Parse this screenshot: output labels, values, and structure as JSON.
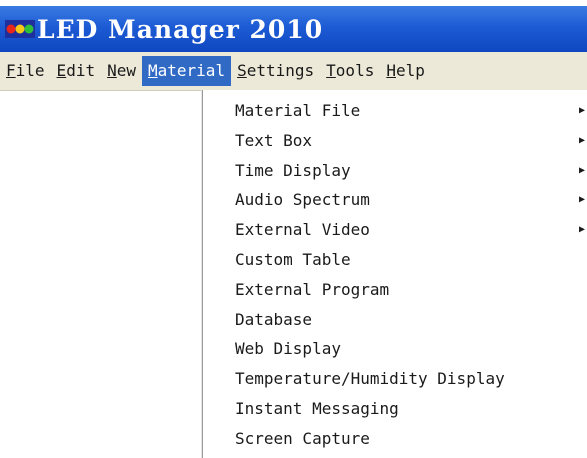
{
  "window": {
    "title": "LED Manager 2010",
    "icon": "led-app-icon"
  },
  "menubar": {
    "items": [
      {
        "label": "File",
        "mnemonic": "F",
        "rest": "ile"
      },
      {
        "label": "Edit",
        "mnemonic": "E",
        "rest": "dit"
      },
      {
        "label": "New",
        "mnemonic": "N",
        "rest": "ew"
      },
      {
        "label": "Material",
        "mnemonic": "M",
        "rest": "aterial",
        "active": true
      },
      {
        "label": "Settings",
        "mnemonic": "S",
        "rest": "ettings"
      },
      {
        "label": "Tools",
        "mnemonic": "T",
        "rest": "ools"
      },
      {
        "label": "Help",
        "mnemonic": "H",
        "rest": "elp"
      }
    ]
  },
  "material_menu": {
    "items": [
      {
        "label": "Material File",
        "submenu": true
      },
      {
        "label": "Text Box",
        "submenu": true
      },
      {
        "label": "Time Display",
        "submenu": true
      },
      {
        "label": "Audio Spectrum",
        "submenu": true
      },
      {
        "label": "External Video",
        "submenu": true
      },
      {
        "label": "Custom Table",
        "submenu": false
      },
      {
        "label": "External Program",
        "submenu": false
      },
      {
        "label": "Database",
        "submenu": false
      },
      {
        "label": "Web Display",
        "submenu": false
      },
      {
        "label": "Temperature/Humidity Display",
        "submenu": false
      },
      {
        "label": "Instant Messaging",
        "submenu": false
      },
      {
        "label": "Screen Capture",
        "submenu": false
      }
    ],
    "submenu_arrow": "▶"
  },
  "colors": {
    "titlebar": "#1c5bd4",
    "menu_highlight": "#316ac5",
    "menubar_bg": "#ece9d8"
  }
}
